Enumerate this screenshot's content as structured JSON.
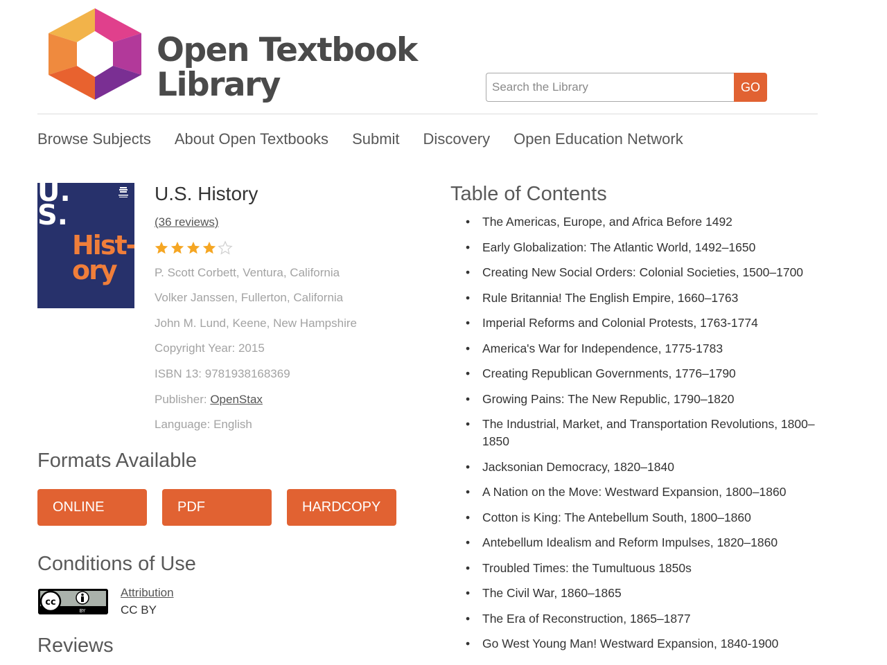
{
  "header": {
    "brand_line1": "Open Textbook",
    "brand_line2": "Library",
    "search_placeholder": "Search the Library",
    "search_button": "GO"
  },
  "nav": [
    "Browse Subjects",
    "About Open Textbooks",
    "Submit",
    "Discovery",
    "Open Education Network"
  ],
  "book": {
    "cover_us": "U.\nS.",
    "cover_title": "Hist-\nory",
    "title": "U.S. History",
    "reviews": "(36 reviews)",
    "rating": 4,
    "rating_max": 5,
    "authors": [
      "P. Scott Corbett, Ventura, California",
      "Volker Janssen, Fullerton, California",
      "John M. Lund, Keene, New Hampshire"
    ],
    "copyright": "Copyright Year: 2015",
    "isbn": "ISBN 13: 9781938168369",
    "publisher_label": "Publisher: ",
    "publisher": "OpenStax",
    "language": "Language: English"
  },
  "formats": {
    "heading": "Formats Available",
    "buttons": [
      "ONLINE",
      "PDF",
      "HARDCOPY"
    ]
  },
  "conditions": {
    "heading": "Conditions of Use",
    "link": "Attribution",
    "license": "CC BY"
  },
  "reviews_heading": "Reviews",
  "toc": {
    "heading": "Table of Contents",
    "items": [
      "The Americas, Europe, and Africa Before 1492",
      "Early Globalization: The Atlantic World, 1492–1650",
      "Creating New Social Orders: Colonial Societies, 1500–1700",
      "Rule Britannia! The English Empire, 1660–1763",
      "Imperial Reforms and Colonial Protests, 1763-1774",
      "America's War for Independence, 1775-1783",
      "Creating Republican Governments, 1776–1790",
      "Growing Pains: The New Republic, 1790–1820",
      "The Industrial, Market, and Transportation Revolutions, 1800–1850",
      "Jacksonian Democracy, 1820–1840",
      "A Nation on the Move: Westward Expansion, 1800–1860",
      "Cotton is King: The Antebellum South, 1800–1860",
      "Antebellum Idealism and Reform Impulses, 1820–1860",
      "Troubled Times: the Tumultuous 1850s",
      "The Civil War, 1860–1865",
      "The Era of Reconstruction, 1865–1877",
      "Go West Young Man! Westward Expansion, 1840-1900"
    ]
  },
  "colors": {
    "accent": "#e16232",
    "star": "#f5a623",
    "cover_bg": "#27316b"
  }
}
